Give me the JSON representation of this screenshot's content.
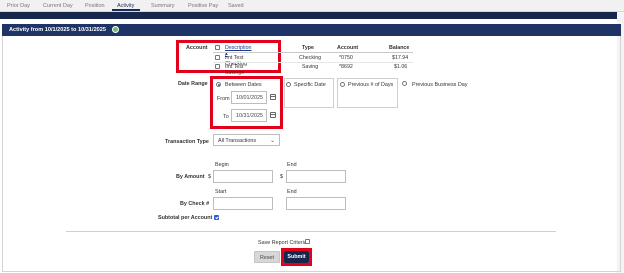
{
  "tabs": [
    {
      "label": "Prior Day"
    },
    {
      "label": "Current Day"
    },
    {
      "label": "Position"
    },
    {
      "label": "Activity",
      "active": true
    },
    {
      "label": "Summary"
    },
    {
      "label": "Positive Pay"
    },
    {
      "label": "Saved"
    }
  ],
  "panel": {
    "title": "Activity from 10/1/2025 to 10/31/2025",
    "info_icon": "info-icon"
  },
  "account": {
    "label": "Account",
    "columns": {
      "description": "Description",
      "type": "Type",
      "account": "Account",
      "balance": "Balance"
    },
    "rows": [
      {
        "description": "Imt Test Checking",
        "type": "Checking",
        "account": "*0750",
        "balance": "$17.94"
      },
      {
        "description": "Imt Test Savings",
        "type": "Saving",
        "account": "*8692",
        "balance": "$1.06"
      }
    ]
  },
  "date_range": {
    "label": "Date Range",
    "options": {
      "between": "Between Dates",
      "specific": "Specific Date",
      "previous_days": "Previous # of Days",
      "previous_business": "Previous Business Day"
    },
    "from_label": "From",
    "from_value": "10/01/2025",
    "to_label": "To",
    "to_value": "10/31/2025"
  },
  "transaction_type": {
    "label": "Transaction Type",
    "selected": "All Transactions"
  },
  "by_amount": {
    "label": "By Amount",
    "begin_label": "Begin",
    "end_label": "End",
    "currency": "$"
  },
  "by_check": {
    "label": "By Check #",
    "start_label": "Start",
    "end_label": "End"
  },
  "subtotal": {
    "label": "Subtotal per Account",
    "checked": true
  },
  "save_criteria": {
    "label": "Save Report Criteria"
  },
  "buttons": {
    "reset": "Reset",
    "submit": "Submit"
  },
  "colors": {
    "header_navy": "#1f3466",
    "highlight_red": "#e3001b",
    "accent_blue": "#2a5fd6"
  }
}
